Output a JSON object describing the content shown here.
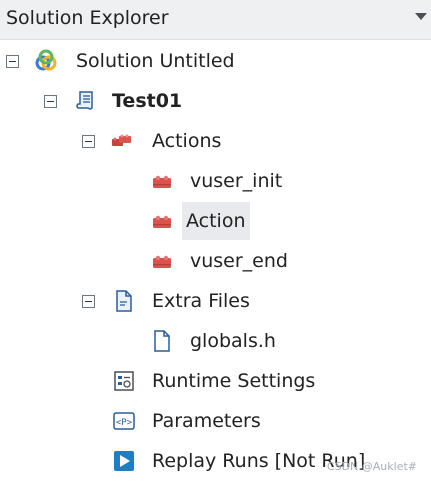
{
  "header": {
    "title": "Solution Explorer"
  },
  "tree": {
    "solution": {
      "label": "Solution Untitled",
      "icon": "solution-icon"
    },
    "script": {
      "label": "Test01",
      "icon": "script-icon"
    },
    "actions": {
      "label": "Actions",
      "icon": "actions-folder-icon"
    },
    "action_items": [
      {
        "label": "vuser_init",
        "icon": "action-brick-icon"
      },
      {
        "label": "Action",
        "icon": "action-brick-icon",
        "selected": true
      },
      {
        "label": "vuser_end",
        "icon": "action-brick-icon"
      }
    ],
    "extra_files": {
      "label": "Extra Files",
      "icon": "extra-files-icon"
    },
    "extra_items": [
      {
        "label": "globals.h",
        "icon": "file-icon"
      }
    ],
    "runtime_settings": {
      "label": "Runtime Settings",
      "icon": "runtime-settings-icon"
    },
    "parameters": {
      "label": "Parameters",
      "icon": "parameters-icon"
    },
    "replay_runs": {
      "label": "Replay Runs [Not Run]",
      "icon": "replay-icon"
    }
  },
  "watermark": "CSDN @Auklet#",
  "colors": {
    "header_bg": "#eef0f2",
    "selected_bg": "#e8eaed",
    "action_red": "#d9534f",
    "replay_blue": "#1f7fc5"
  }
}
